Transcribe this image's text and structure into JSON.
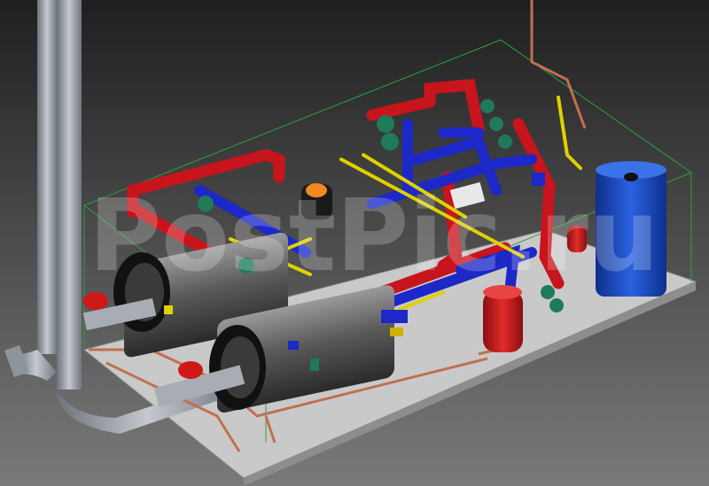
{
  "scene": {
    "watermark": "PostPic.ru",
    "colors": {
      "background_top": "#1f1f1f",
      "background_bottom": "#7a7a7a",
      "platform": "#c9c9c9",
      "hot_pipe": "#c8141c",
      "cold_pipe": "#1c28c8",
      "gas_pipe": "#e0d000",
      "drain_pipe": "#c07050",
      "boiler_body": "#4a4a4a",
      "expansion_tank": "#d01818",
      "storage_tank": "#1a50c8",
      "pump": "#1f7a5a",
      "chimney": "#9aa0a8",
      "boundary_box": "#2aa040"
    },
    "components": [
      {
        "name": "chimney-left",
        "icon": "chimney"
      },
      {
        "name": "chimney-right",
        "icon": "chimney"
      },
      {
        "name": "boiler-1",
        "icon": "boiler"
      },
      {
        "name": "boiler-2",
        "icon": "boiler"
      },
      {
        "name": "burner-1",
        "icon": "burner"
      },
      {
        "name": "burner-2",
        "icon": "burner"
      },
      {
        "name": "expansion-tank",
        "icon": "tank"
      },
      {
        "name": "storage-tank",
        "icon": "tank"
      },
      {
        "name": "pump-group",
        "icon": "pump"
      },
      {
        "name": "manifold",
        "icon": "manifold"
      }
    ]
  }
}
